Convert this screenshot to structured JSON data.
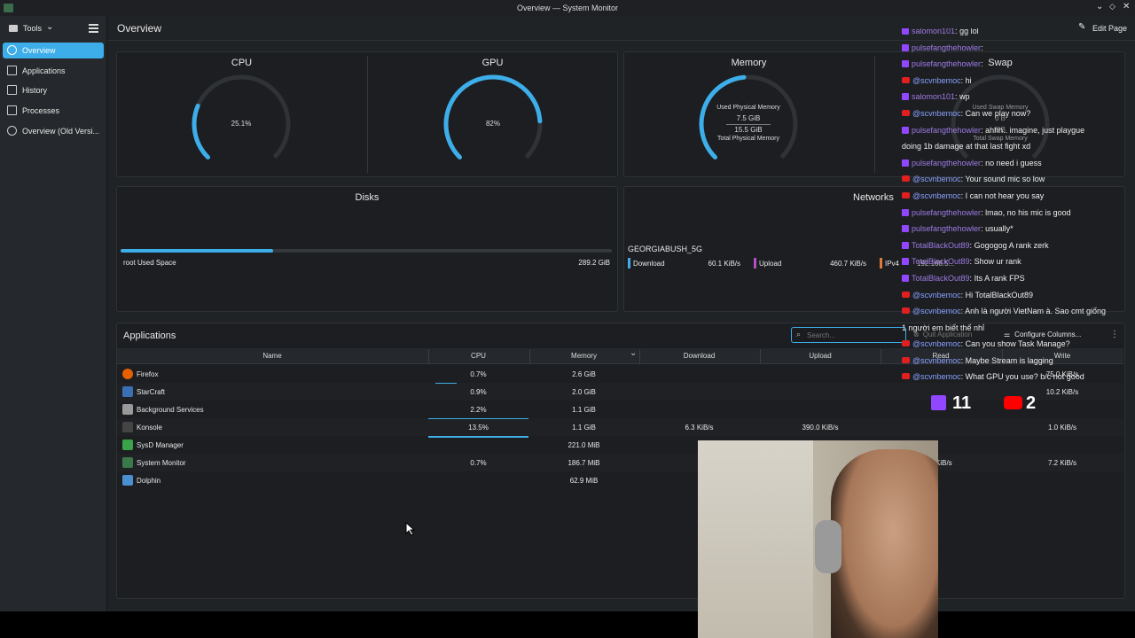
{
  "window": {
    "title": "Overview — System Monitor"
  },
  "toolbar": {
    "tools_label": "Tools",
    "page_title": "Overview",
    "edit_page_label": "Edit Page"
  },
  "sidebar": {
    "items": [
      {
        "label": "Overview",
        "icon": "overview-icon",
        "active": true
      },
      {
        "label": "Applications",
        "icon": "grid-icon"
      },
      {
        "label": "History",
        "icon": "history-icon"
      },
      {
        "label": "Processes",
        "icon": "processes-icon"
      },
      {
        "label": "Overview (Old Versi...",
        "icon": "overview-old-icon"
      }
    ]
  },
  "gauges": {
    "cpu": {
      "title": "CPU",
      "value_label": "25.1%",
      "fraction": 0.251
    },
    "gpu": {
      "title": "GPU",
      "value_label": "82%",
      "fraction": 0.82
    },
    "memory": {
      "title": "Memory",
      "used_caption": "Used Physical Memory",
      "used": "7.5 GiB",
      "total": "15.5 GiB",
      "total_caption": "Total Physical Memory",
      "fraction": 0.48
    },
    "swap": {
      "title": "Swap",
      "used_caption": "Used Swap Memory",
      "used": "0 B",
      "total": "0 B",
      "total_caption": "Total Swap Memory"
    }
  },
  "disks": {
    "title": "Disks",
    "label": "root Used Space",
    "value": "289.2 GiB",
    "fraction": 0.31
  },
  "networks": {
    "title": "Networks",
    "iface": "GEORGIABUSH_5G",
    "download_label": "Download",
    "download_value": "60.1 KiB/s",
    "upload_label": "Upload",
    "upload_value": "460.7 KiB/s",
    "ipv4_label": "IPv4",
    "ipv4_value": "192.168.5..."
  },
  "applications": {
    "title": "Applications",
    "search_placeholder": "Search...",
    "quit_label": "Quit Application",
    "configure_label": "Configure Columns...",
    "columns": [
      "Name",
      "CPU",
      "Memory",
      "Download",
      "Upload",
      "Read",
      "Write"
    ],
    "rows": [
      {
        "name": "Firefox",
        "icon": "firefox-icon",
        "cpu": "0.7%",
        "mem": "2.6 GiB",
        "down": "",
        "up": "",
        "read": "",
        "write": "75.0 KiB/s"
      },
      {
        "name": "StarCraft",
        "icon": "starcraft-icon",
        "cpu": "0.9%",
        "mem": "2.0 GiB",
        "down": "",
        "up": "",
        "read": "",
        "write": "10.2 KiB/s"
      },
      {
        "name": "Background Services",
        "icon": "background-services-icon",
        "cpu": "2.2%",
        "mem": "1.1 GiB",
        "down": "",
        "up": "",
        "read": "",
        "write": ""
      },
      {
        "name": "Konsole",
        "icon": "konsole-icon",
        "cpu": "13.5%",
        "mem": "1.1 GiB",
        "down": "6.3 KiB/s",
        "up": "390.0 KiB/s",
        "read": "",
        "write": "1.0 KiB/s"
      },
      {
        "name": "SysD Manager",
        "icon": "sysd-manager-icon",
        "cpu": "",
        "mem": "221.0 MiB",
        "down": "",
        "up": "",
        "read": "",
        "write": ""
      },
      {
        "name": "System Monitor",
        "icon": "system-monitor-icon",
        "cpu": "0.7%",
        "mem": "186.7 MiB",
        "down": "",
        "up": "",
        "read": "5 KiB/s",
        "write": "7.2 KiB/s"
      },
      {
        "name": "Dolphin",
        "icon": "dolphin-icon",
        "cpu": "",
        "mem": "62.9 MiB",
        "down": "",
        "up": "",
        "read": "",
        "write": ""
      }
    ]
  },
  "chat": {
    "messages": [
      {
        "platform": "twitch",
        "user": "salomon101",
        "text": "gg lol"
      },
      {
        "platform": "twitch",
        "user": "pulsefangthehowler",
        "text": ""
      },
      {
        "platform": "twitch",
        "user": "pulsefangthehowler",
        "text": ""
      },
      {
        "platform": "youtube",
        "user": "@scvnbemoc",
        "text": "hi"
      },
      {
        "platform": "twitch",
        "user": "salomon101",
        "text": "wp"
      },
      {
        "platform": "youtube",
        "user": "@scvnbemoc",
        "text": "Can we play now?"
      },
      {
        "platform": "twitch",
        "user": "pulsefangthehowler",
        "text": "ahhh.. imagine, just playgue"
      },
      {
        "platform": "none",
        "user": "",
        "text": "doing 1b damage at that last fight xd"
      },
      {
        "platform": "twitch",
        "user": "pulsefangthehowler",
        "text": "no need i guess"
      },
      {
        "platform": "youtube",
        "user": "@scvnbemoc",
        "text": "Your sound mic so low"
      },
      {
        "platform": "youtube",
        "user": "@scvnbemoc",
        "text": "I can not hear you say"
      },
      {
        "platform": "twitch",
        "user": "pulsefangthehowler",
        "text": "lmao, no his mic is good"
      },
      {
        "platform": "twitch",
        "user": "pulsefangthehowler",
        "text": "usually*"
      },
      {
        "platform": "twitch",
        "user": "TotalBlackOut89",
        "text": "Gogogog A rank zerk"
      },
      {
        "platform": "twitch",
        "user": "TotalBlackOut89",
        "text": "Show ur rank"
      },
      {
        "platform": "twitch",
        "user": "TotalBlackOut89",
        "text": "Its A rank FPS"
      },
      {
        "platform": "youtube",
        "user": "@scvnbemoc",
        "text": "Hi TotalBlackOut89"
      },
      {
        "platform": "youtube",
        "user": "@scvnbemoc",
        "text": "Anh là người VietNam à. Sao cmt giống"
      },
      {
        "platform": "none",
        "user": "",
        "text": "1 người em biết thế nhỉ"
      },
      {
        "platform": "youtube",
        "user": "@scvnbemoc",
        "text": "Can you show Task Manage?"
      },
      {
        "platform": "youtube",
        "user": "@scvnbemoc",
        "text": "Maybe Stream is lagging"
      },
      {
        "platform": "youtube",
        "user": "@scvnbemoc",
        "text": "What GPU you use? b/c not good"
      }
    ],
    "twitch_count": "11",
    "youtube_count": "2"
  },
  "colors": {
    "accent": "#3daee9",
    "download": "#3daee9",
    "upload": "#b44fc4",
    "ipv4": "#e07a3a"
  }
}
